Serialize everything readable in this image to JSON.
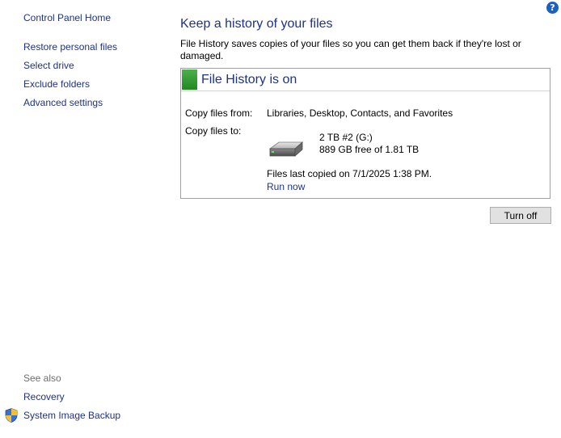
{
  "sidebar": {
    "home": "Control Panel Home",
    "items": [
      {
        "label": "Restore personal files"
      },
      {
        "label": "Select drive"
      },
      {
        "label": "Exclude folders"
      },
      {
        "label": "Advanced settings"
      }
    ]
  },
  "main": {
    "title": "Keep a history of your files",
    "description": "File History saves copies of your files so you can get them back if they're lost or damaged.",
    "status": {
      "title": "File History is on",
      "accent_color": "#2e9e2e",
      "copy_from_label": "Copy files from:",
      "copy_from_value": "Libraries, Desktop, Contacts, and Favorites",
      "copy_to_label": "Copy files to:",
      "drive_name": "2 TB #2 (G:)",
      "drive_space": "889 GB free of 1.81 TB",
      "drive_icon": "hard-drive-icon",
      "last_copied": "Files last copied on 7/1/2025 1:38 PM.",
      "run_now": "Run now"
    },
    "turn_off_button": "Turn off"
  },
  "see_also": {
    "heading": "See also",
    "items": [
      {
        "label": "Recovery"
      },
      {
        "label": "System Image Backup",
        "icon": "shield-icon"
      }
    ]
  },
  "help": {
    "glyph": "?",
    "icon": "help-icon"
  },
  "colors": {
    "link": "#1e3287",
    "accent": "#2e9e2e"
  }
}
